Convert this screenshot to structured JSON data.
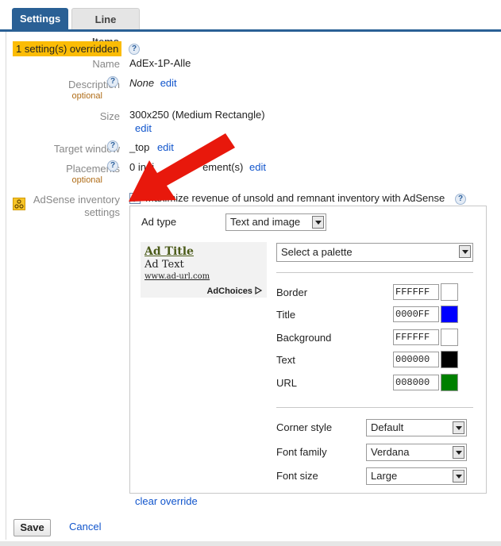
{
  "tabs": {
    "settings": "Settings",
    "line_items": "Line Items"
  },
  "override_badge": "1 setting(s) overridden",
  "help_glyph": "?",
  "fields": {
    "name_label": "Name",
    "name_value": "AdEx-1P-Alle",
    "description_label": "Description",
    "description_optional": "optional",
    "description_value": "None",
    "size_label": "Size",
    "size_value": "300x250 (Medium Rectangle)",
    "target_label": "Target window",
    "target_value": "_top",
    "placements_label": "Placements",
    "placements_optional": "optional",
    "placements_value_start": "0 indi",
    "placements_value_end": "ement(s)",
    "edit": "edit"
  },
  "adsense": {
    "label_line1": "AdSense inventory",
    "label_line2": "settings",
    "checkbox_label": "Maximize revenue of unsold and remnant inventory with AdSense",
    "checked": true
  },
  "panel": {
    "ad_type_label": "Ad type",
    "ad_type_value": "Text and image",
    "palette_placeholder": "Select a palette",
    "preview": {
      "title": "Ad Title",
      "text": "Ad Text",
      "url": "www.ad-url.com",
      "choices": "AdChoices"
    },
    "colors": [
      {
        "label": "Border",
        "hex": "FFFFFF",
        "swatch": "#FFFFFF"
      },
      {
        "label": "Title",
        "hex": "0000FF",
        "swatch": "#0000FF"
      },
      {
        "label": "Background",
        "hex": "FFFFFF",
        "swatch": "#FFFFFF"
      },
      {
        "label": "Text",
        "hex": "000000",
        "swatch": "#000000"
      },
      {
        "label": "URL",
        "hex": "008000",
        "swatch": "#008000"
      }
    ],
    "corner_style_label": "Corner style",
    "corner_style_value": "Default",
    "font_family_label": "Font family",
    "font_family_value": "Verdana",
    "font_size_label": "Font size",
    "font_size_value": "Large"
  },
  "clear_override": "clear override",
  "actions": {
    "save": "Save",
    "cancel": "Cancel"
  },
  "colors": {
    "tab_active": "#2a6095",
    "link": "#1155cc",
    "badge": "#fbbc05",
    "arrow": "#e8180c"
  }
}
